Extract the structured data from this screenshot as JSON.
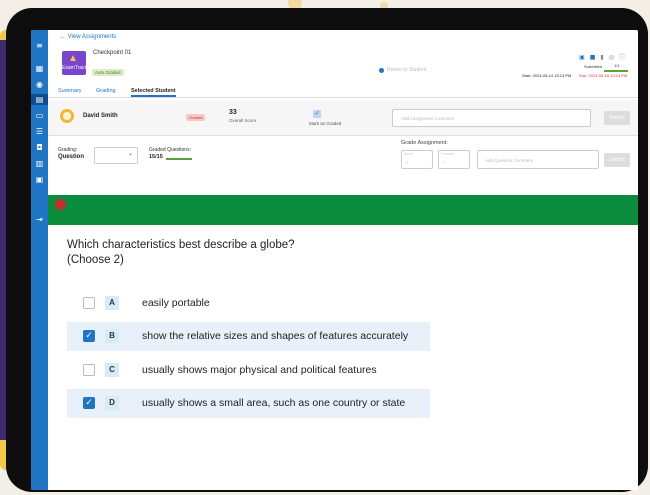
{
  "header": {
    "back_link": "← View Assignments",
    "assignment_title": "Checkpoint 01",
    "logo_text": "ExamTrack",
    "auto_graded_badge": "Auto Graded",
    "faded_title": "Return to Student",
    "submitted_label": "Submitted",
    "submitted_value": "1/1",
    "start_label": "Start: 2024-05-14 15:13 PM",
    "due_label": "Due: 2024-05-18 13:13 PM"
  },
  "tabs": [
    "Summary",
    "Grading",
    "Selected Student"
  ],
  "student": {
    "name": "David Smith",
    "status_badge": "Graded",
    "overall_score": "33",
    "overall_score_label": "Overall Score",
    "mark_as_graded_label": "Mark as Graded",
    "comment_placeholder": "Add Assignment Comment",
    "submit_label": "Submit"
  },
  "grading": {
    "label": "Grading:",
    "value": "Question",
    "graded_questions_label": "Graded Questions:",
    "graded_questions_value": "15/15",
    "grade_assignment_label": "Grade Assignment:",
    "box1_label": "Score",
    "box1_value": "0",
    "box2_label": "Possible",
    "box2_value": "1",
    "question_comment_placeholder": "Add Question Comment",
    "submit_label": "Submit"
  },
  "question": {
    "line1": "Which characteristics best describe a globe?",
    "line2": "(Choose 2)",
    "options": [
      {
        "letter": "A",
        "text": "easily portable",
        "checked": false
      },
      {
        "letter": "B",
        "text": "show the relative sizes and shapes of features accurately",
        "checked": true
      },
      {
        "letter": "C",
        "text": "usually shows major physical and political features",
        "checked": false
      },
      {
        "letter": "D",
        "text": "usually shows a small area, such as one country or state",
        "checked": true
      }
    ]
  },
  "colors": {
    "primary": "#1f74c4",
    "green_banner": "#0a8c3c",
    "red_marker": "#c2302c"
  }
}
